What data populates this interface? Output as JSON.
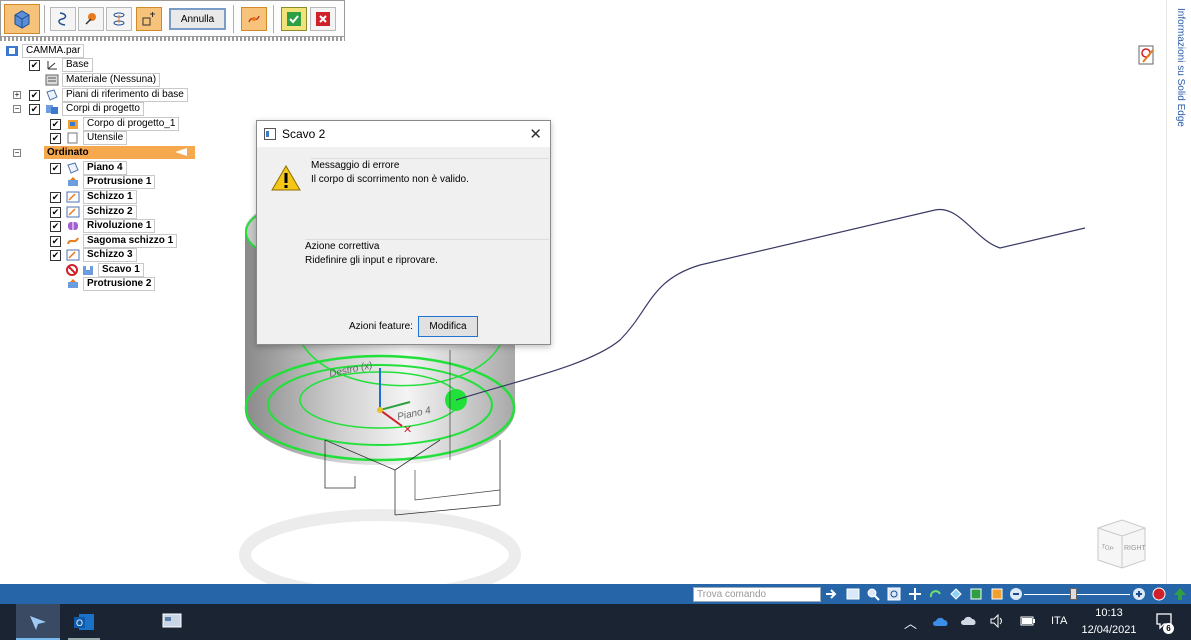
{
  "toolbar": {
    "annulla_label": "Annulla"
  },
  "tree": {
    "root": "CAMMA.par",
    "items": [
      {
        "label": "Base",
        "bold": false
      },
      {
        "label": "Materiale (Nessuna)",
        "bold": false
      },
      {
        "label": "Piani di riferimento di base",
        "bold": false
      },
      {
        "label": "Corpi di progetto",
        "bold": false
      },
      {
        "label": "Corpo di progetto_1",
        "bold": false
      },
      {
        "label": "Utensile",
        "bold": false
      },
      {
        "label": "Ordinato",
        "bold": true
      },
      {
        "label": "Piano 4",
        "bold": true
      },
      {
        "label": "Protrusione 1",
        "bold": true
      },
      {
        "label": "Schizzo 1",
        "bold": true
      },
      {
        "label": "Schizzo 2",
        "bold": true
      },
      {
        "label": "Rivoluzione 1",
        "bold": true
      },
      {
        "label": "Sagoma schizzo 1",
        "bold": true
      },
      {
        "label": "Schizzo 3",
        "bold": true
      },
      {
        "label": "Scavo 1",
        "bold": true
      },
      {
        "label": "Protrusione 2",
        "bold": true
      }
    ]
  },
  "dialog": {
    "title": "Scavo 2",
    "error_title": "Messaggio di errore",
    "error_text": "Il corpo di scorrimento non è valido.",
    "action_title": "Azione correttiva",
    "action_text": "Ridefinire gli input e riprovare.",
    "feature_actions_label": "Azioni feature:",
    "modify_button": "Modifica"
  },
  "viewport": {
    "label_destro": "Destro (x)",
    "label_piano": "Piano 4",
    "viewcube_right": "RIGHT",
    "viewcube_top": "TOP"
  },
  "side_panel": {
    "label": "Informazioni su Solid Edge"
  },
  "statusbar": {
    "search_placeholder": "Trova comando"
  },
  "taskbar": {
    "language": "ITA",
    "time": "10:13",
    "date": "12/04/2021",
    "notifications": "6"
  },
  "colors": {
    "accent_orange": "#f6a84f",
    "status_blue": "#2565a8",
    "taskbar": "#1b2433",
    "sketch_green": "#22e03a"
  }
}
